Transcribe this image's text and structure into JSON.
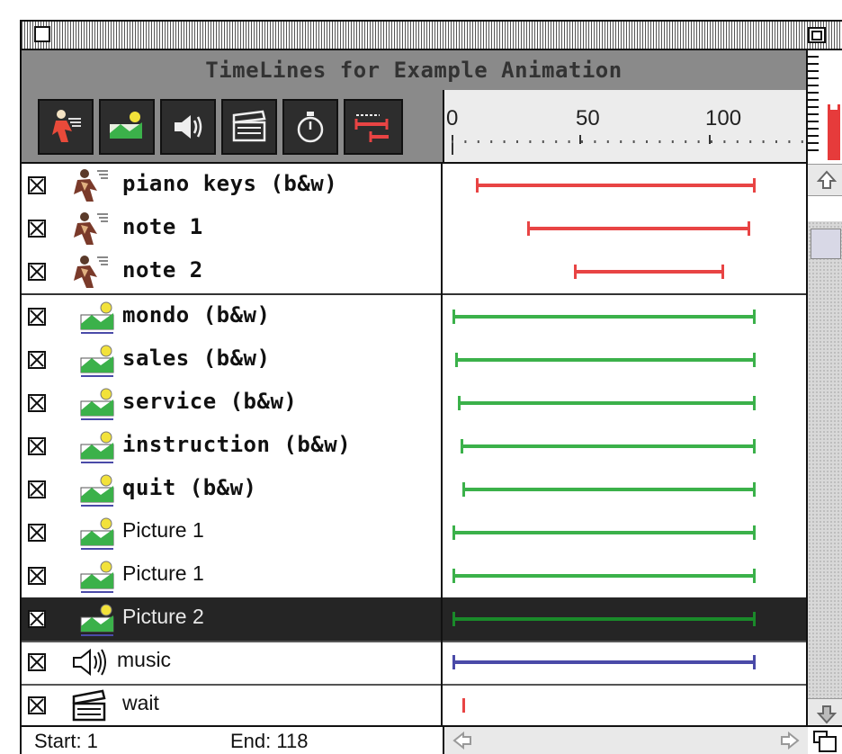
{
  "window": {
    "title": "TimeLines for Example Animation"
  },
  "toolbar": {
    "tools": [
      {
        "icon": "actor-icon"
      },
      {
        "icon": "picture-icon"
      },
      {
        "icon": "sound-icon"
      },
      {
        "icon": "clapboard-icon"
      },
      {
        "icon": "stopwatch-icon"
      },
      {
        "icon": "timeline-icon"
      }
    ]
  },
  "ruler": {
    "labels": [
      "0",
      "50",
      "100"
    ]
  },
  "tracks": [
    {
      "name": "piano keys (b&w)",
      "type": "actor",
      "start": 10,
      "end": 118,
      "color": "#e84444"
    },
    {
      "name": "note 1",
      "type": "actor",
      "start": 30,
      "end": 116,
      "color": "#e84444"
    },
    {
      "name": "note 2",
      "type": "actor",
      "start": 48,
      "end": 106,
      "color": "#e84444"
    },
    {
      "name": "mondo (b&w)",
      "type": "picture",
      "start": 1,
      "end": 118,
      "color": "#3bb14a"
    },
    {
      "name": "sales (b&w)",
      "type": "picture",
      "start": 2,
      "end": 118,
      "color": "#3bb14a"
    },
    {
      "name": "service (b&w)",
      "type": "picture",
      "start": 3,
      "end": 118,
      "color": "#3bb14a"
    },
    {
      "name": "instruction (b&w)",
      "type": "picture",
      "start": 4,
      "end": 118,
      "color": "#3bb14a"
    },
    {
      "name": "quit (b&w)",
      "type": "picture",
      "start": 5,
      "end": 118,
      "color": "#3bb14a"
    },
    {
      "name": "Picture 1",
      "type": "picture",
      "start": 1,
      "end": 118,
      "color": "#3bb14a"
    },
    {
      "name": "Picture 1",
      "type": "picture",
      "start": 1,
      "end": 118,
      "color": "#3bb14a"
    },
    {
      "name": "Picture 2",
      "type": "picture",
      "start": 1,
      "end": 118,
      "color": "#1a8a2a",
      "selected": true
    },
    {
      "name": "music",
      "type": "sound",
      "start": 1,
      "end": 118,
      "color": "#4a4aa8"
    },
    {
      "name": "wait",
      "type": "wait",
      "start": 5,
      "end": 5,
      "color": "#e84444"
    }
  ],
  "footer": {
    "start_label": "Start: 1",
    "end_label": "End: 118"
  }
}
